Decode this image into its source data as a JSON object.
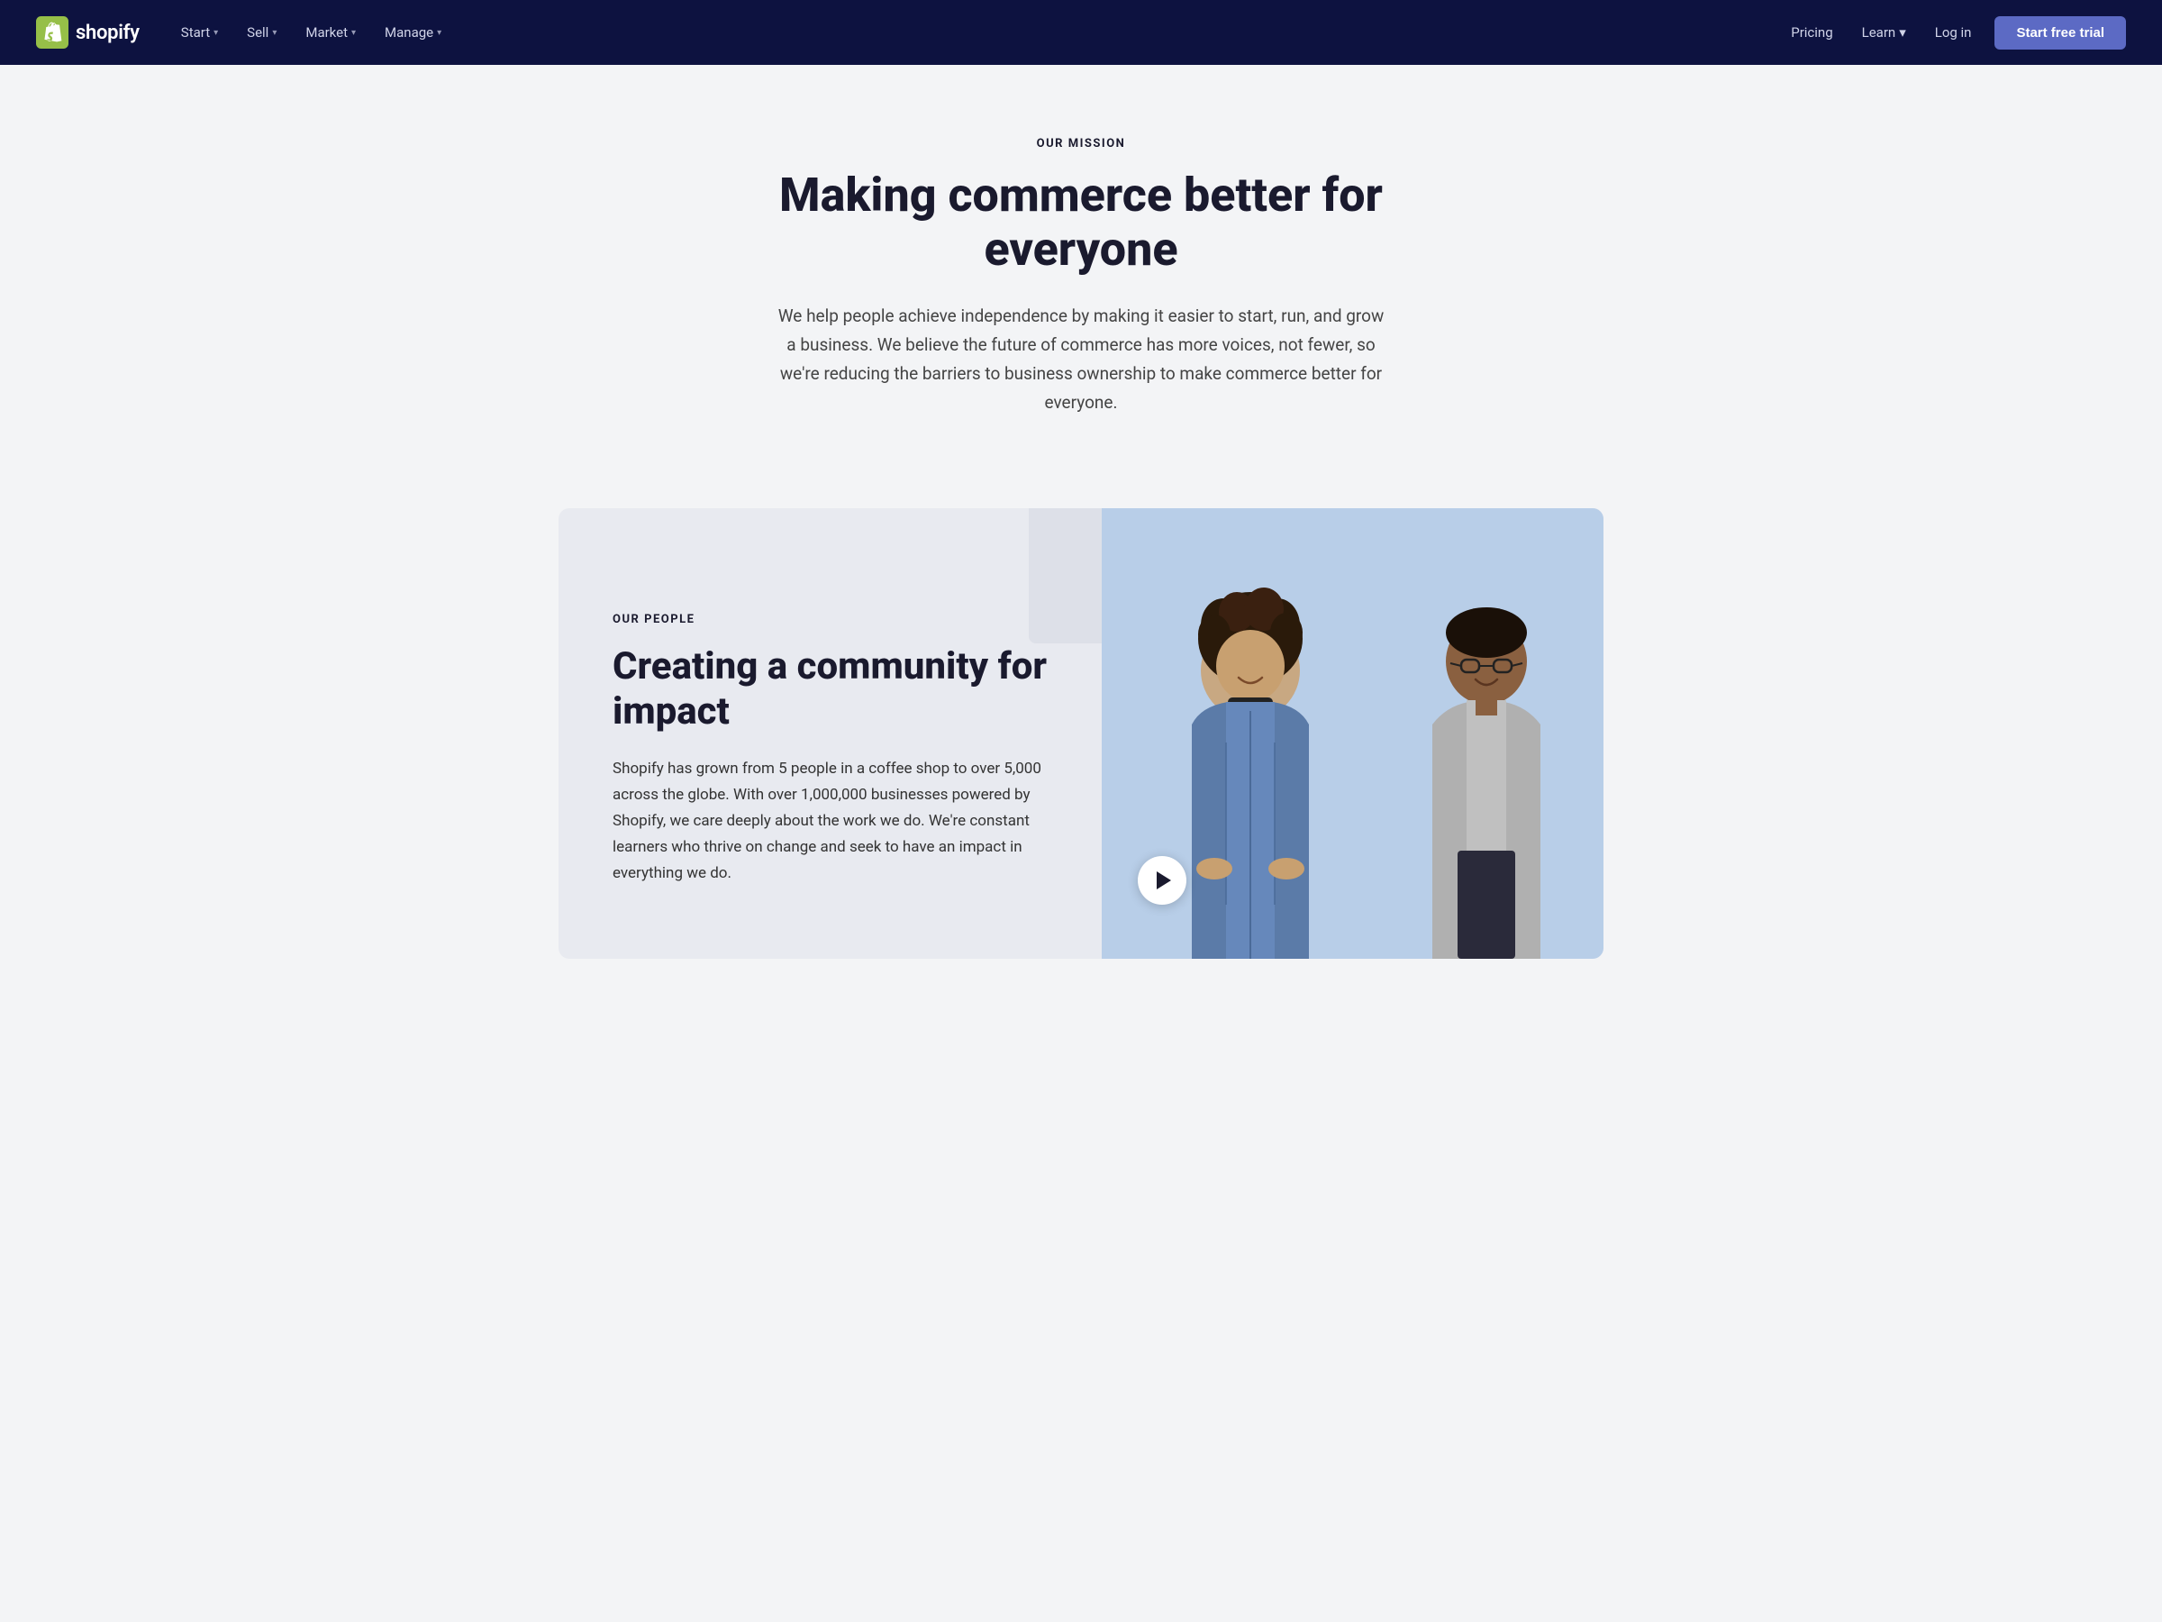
{
  "nav": {
    "logo_text": "shopify",
    "primary_items": [
      {
        "label": "Start",
        "has_chevron": true
      },
      {
        "label": "Sell",
        "has_chevron": true
      },
      {
        "label": "Market",
        "has_chevron": true
      },
      {
        "label": "Manage",
        "has_chevron": true
      }
    ],
    "secondary_items": [
      {
        "label": "Pricing",
        "has_chevron": false
      },
      {
        "label": "Learn",
        "has_chevron": true
      },
      {
        "label": "Log in",
        "has_chevron": false
      }
    ],
    "cta_label": "Start free trial"
  },
  "hero": {
    "eyebrow": "OUR MISSION",
    "title": "Making commerce better for everyone",
    "description": "We help people achieve independence by making it easier to start, run, and grow a business. We believe the future of commerce has more voices, not fewer, so we're reducing the barriers to business ownership to make commerce better for everyone."
  },
  "people": {
    "eyebrow": "OUR PEOPLE",
    "title": "Creating a community for impact",
    "description": "Shopify has grown from 5 people in a coffee shop to over 5,000 across the globe. With over 1,000,000 businesses powered by Shopify, we care deeply about the work we do. We're constant learners who thrive on change and seek to have an impact in everything we do."
  },
  "colors": {
    "nav_bg": "#0d1240",
    "cta_bg": "#5c6ac4",
    "body_bg": "#f3f4f6",
    "card_bg": "#e8eaf0",
    "image_bg": "#b8cee8",
    "gray_box": "#dde0e8"
  }
}
